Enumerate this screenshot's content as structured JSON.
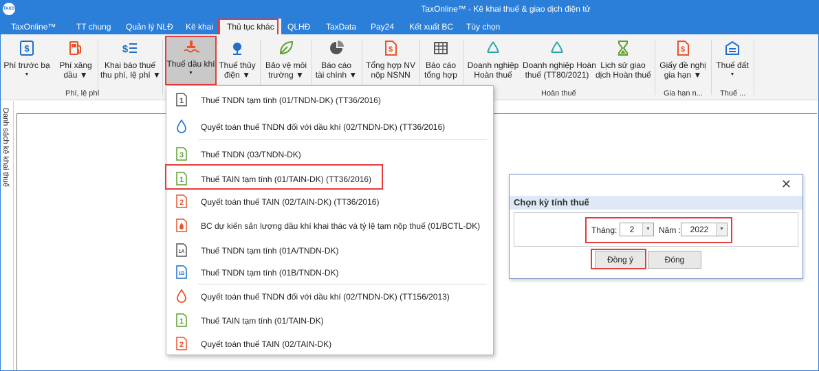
{
  "titlebar": {
    "logo_text": "TAXO",
    "title": "TaxOnline™ - Kê khai thuế & giao dịch điện tử"
  },
  "menu": {
    "items": [
      "TaxOnline™",
      "TT chung",
      "Quản lý NLĐ",
      "Kê khai",
      "Thủ tục khác",
      "QLHĐ",
      "TaxData",
      "Pay24",
      "Kết xuất BC",
      "Tùy chọn"
    ]
  },
  "ribbon": {
    "buttons": [
      {
        "l1": "Phí trước bạ",
        "l2": "▼"
      },
      {
        "l1": "Phí xăng",
        "l2": "dầu ▼"
      },
      {
        "l1": "Khai báo thuế",
        "l2": "thu phí, lệ phí ▼"
      },
      {
        "l1": "Thuế dầu khí",
        "l2": "▼"
      },
      {
        "l1": "Thuế thủy",
        "l2": "điện ▼"
      },
      {
        "l1": "Bảo vệ môi",
        "l2": "trường ▼"
      },
      {
        "l1": "Báo cáo",
        "l2": "tài chính ▼"
      },
      {
        "l1": "Tổng hợp NV",
        "l2": "nộp NSNN"
      },
      {
        "l1": "Báo cáo",
        "l2": "tổng hợp"
      },
      {
        "l1": "Doanh nghiệp",
        "l2": "Hoàn thuế"
      },
      {
        "l1": "Doanh nghiệp Hoàn",
        "l2": "thuế (TT80/2021)"
      },
      {
        "l1": "Lịch sử giao",
        "l2": "dịch Hoàn thuế"
      },
      {
        "l1": "Giấy đề nghị",
        "l2": "gia hạn ▼"
      },
      {
        "l1": "Thuế đất",
        "l2": "▼"
      }
    ],
    "groups": [
      "Phí, lệ phí",
      "Hoàn thuế",
      "Gia hạn n...",
      "Thuế ..."
    ]
  },
  "sidepanel": {
    "label": "Danh sách kê khai thuế"
  },
  "dropdown": {
    "items": [
      {
        "icon": "1",
        "color": "#555555",
        "label": "Thuế TNDN tạm tính (01/TNDN-DK) (TT36/2016)"
      },
      {
        "icon": "drop",
        "color": "#2b7fd8",
        "label": "Quyết toán thuế TNDN đối với dầu khí (02/TNDN-DK) (TT36/2016)"
      },
      {
        "icon": "3",
        "color": "#5aa02c",
        "label": "Thuế TNDN (03/TNDN-DK)"
      },
      {
        "icon": "1",
        "color": "#5aa02c",
        "label": "Thuế TAIN tạm tính (01/TAIN-DK) (TT36/2016)"
      },
      {
        "icon": "2",
        "color": "#e8532b",
        "label": "Quyết  toán thuế TAIN (02/TAIN-DK) (TT36/2016)"
      },
      {
        "icon": "flame",
        "color": "#e8532b",
        "label": "BC dự kiến sản lượng dầu khí  khai thác và tỷ lệ tạm nộp thuế (01/BCTL-DK)"
      },
      {
        "icon": "1A",
        "color": "#555555",
        "label": "Thuế TNDN tạm tính (01A/TNDN-DK)"
      },
      {
        "icon": "1B",
        "color": "#1f6fc9",
        "label": "Thuế TNDN tạm tính (01B/TNDN-DK)"
      },
      {
        "icon": "drop",
        "color": "#e8532b",
        "label": "Quyết toán thuế TNDN đối với dầu khí (02/TNDN-DK) (TT156/2013)"
      },
      {
        "icon": "1",
        "color": "#5aa02c",
        "label": "Thuế TAIN tạm tính (01/TAIN-DK)"
      },
      {
        "icon": "2",
        "color": "#e8532b",
        "label": "Quyết toán thuế TAIN (02/TAIN-DK)"
      }
    ]
  },
  "dialog": {
    "close": "✕",
    "title": "Chọn kỳ tính thuế",
    "month_label": "Tháng:",
    "month_value": "2",
    "year_label": "Năm :",
    "year_value": "2022",
    "ok": "Đồng ý",
    "close_button": "Đóng"
  }
}
